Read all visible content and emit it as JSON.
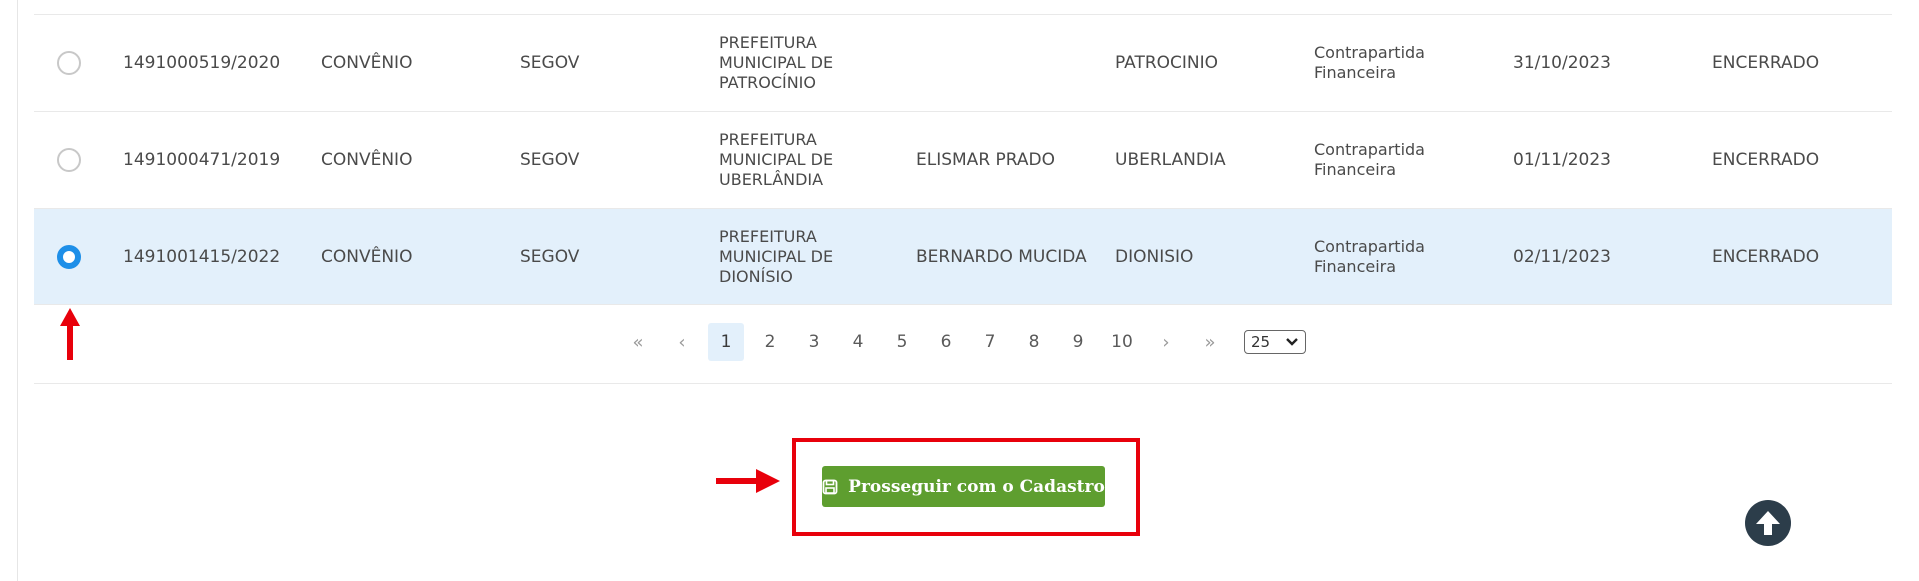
{
  "table": {
    "rows": [
      {
        "number": "1491000519/2020",
        "type": "CONVÊNIO",
        "org": "SEGOV",
        "entity": [
          "PREFEITURA",
          "MUNICIPAL DE",
          "PATROCÍNIO"
        ],
        "parliamentarian": "",
        "municipality": "PATROCINIO",
        "category": [
          "Contrapartida",
          "Financeira"
        ],
        "date": "31/10/2023",
        "status": "ENCERRADO",
        "selected": false
      },
      {
        "number": "1491000471/2019",
        "type": "CONVÊNIO",
        "org": "SEGOV",
        "entity": [
          "PREFEITURA",
          "MUNICIPAL DE",
          "UBERLÂNDIA"
        ],
        "parliamentarian": "ELISMAR PRADO",
        "municipality": "UBERLANDIA",
        "category": [
          "Contrapartida",
          "Financeira"
        ],
        "date": "01/11/2023",
        "status": "ENCERRADO",
        "selected": false
      },
      {
        "number": "1491001415/2022",
        "type": "CONVÊNIO",
        "org": "SEGOV",
        "entity": [
          "PREFEITURA",
          "MUNICIPAL DE",
          "DIONÍSIO"
        ],
        "parliamentarian": "BERNARDO MUCIDA",
        "municipality": "DIONISIO",
        "category": [
          "Contrapartida",
          "Financeira"
        ],
        "date": "02/11/2023",
        "status": "ENCERRADO",
        "selected": true
      }
    ]
  },
  "pagination": {
    "first": "«",
    "prev": "‹",
    "pages": [
      "1",
      "2",
      "3",
      "4",
      "5",
      "6",
      "7",
      "8",
      "9",
      "10"
    ],
    "active_page": "1",
    "next": "›",
    "last": "»",
    "page_size": "25"
  },
  "actions": {
    "proceed_label": "Prosseguir com o Cadastro"
  },
  "icons": {
    "save": "save-icon",
    "scroll_top": "arrow-up-circle-icon",
    "select_caret": "chevron-down-icon"
  },
  "colors": {
    "selected_row": "#e3f0fb",
    "radio_checked": "#1e8fe8",
    "button": "#5e9e2f",
    "annotation": "#e8000b",
    "scroll_top": "#2c3d4a"
  }
}
